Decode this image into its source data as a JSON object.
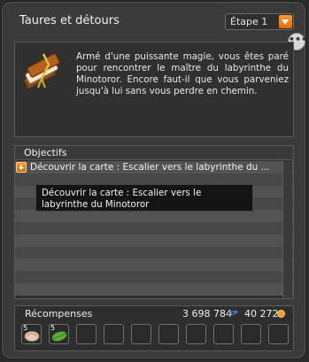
{
  "window": {
    "title": "Taures et détours",
    "step_selector": {
      "selected": "Étape 1"
    }
  },
  "description": {
    "text": "Armé d'une puissante magie, vous êtes paré pour rencontrer le maître du labyrinthe du Minotoror. Encore faut-il que vous parveniez jusqu'à lui sans vous perdre en chemin.",
    "icon": "book-icon"
  },
  "objectives": {
    "title": "Objectifs",
    "items": [
      {
        "label": "Découvrir la carte : Escalier vers le labyrinthe du ...",
        "icon": "plus-icon"
      }
    ],
    "tooltip": "Découvrir la carte : Escalier vers le labyrinthe du Minotoror"
  },
  "rewards": {
    "title": "Récompenses",
    "xp": "3 698 784",
    "xp_unit": "XP",
    "kamas": "40 272",
    "items": [
      {
        "icon": "shell-icon",
        "quantity": "5"
      },
      {
        "icon": "leaf-icon",
        "quantity": "5"
      }
    ]
  },
  "colors": {
    "accent": "#e8821a",
    "panel_bg": "#3a3a3a",
    "tooltip_bg": "#141414"
  }
}
